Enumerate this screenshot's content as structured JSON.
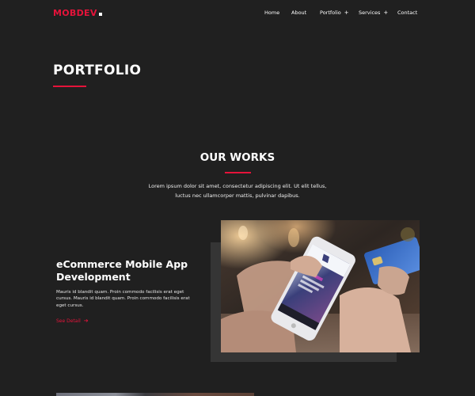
{
  "brand": {
    "name": "MOBDEV",
    "accent": "#e5133a"
  },
  "nav": {
    "items": [
      {
        "label": "Home",
        "has_submenu": false
      },
      {
        "label": "About",
        "has_submenu": false
      },
      {
        "label": "Portfolio",
        "has_submenu": true
      },
      {
        "label": "Services",
        "has_submenu": true
      },
      {
        "label": "Contact",
        "has_submenu": false
      }
    ],
    "submenu_glyph": "+"
  },
  "page": {
    "title": "PORTFOLIO"
  },
  "section": {
    "title": "OUR WORKS",
    "description": "Lorem ipsum dolor sit amet, consectetur adipiscing elit. Ut elit tellus, luctus nec ullamcorper mattis, pulvinar dapibus."
  },
  "work": {
    "title": "eCommerce Mobile App Development",
    "description": "Mauris id blandit quam. Proin commodo facilisis erat eget cursus. Mauris id blandit quam. Proin commodo facilisis erat eget cursus.",
    "link_label": "See Detail",
    "link_icon": "arrow-right-icon",
    "image": "photo-hand-holding-smartphone-shopping-app-and-credit-card"
  },
  "colors": {
    "background": "#202020",
    "card_shadow": "#353535",
    "text": "#ffffff"
  }
}
